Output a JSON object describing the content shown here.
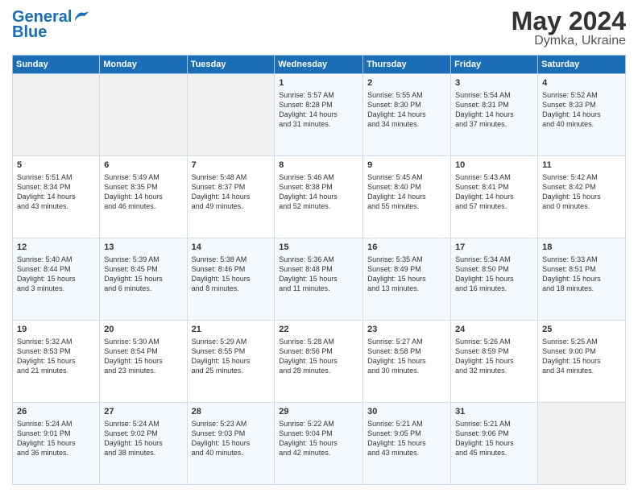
{
  "header": {
    "logo_line1": "General",
    "logo_line2": "Blue",
    "month": "May 2024",
    "location": "Dymka, Ukraine"
  },
  "weekdays": [
    "Sunday",
    "Monday",
    "Tuesday",
    "Wednesday",
    "Thursday",
    "Friday",
    "Saturday"
  ],
  "weeks": [
    [
      {
        "day": null,
        "info": null
      },
      {
        "day": null,
        "info": null
      },
      {
        "day": null,
        "info": null
      },
      {
        "day": "1",
        "info": "Sunrise: 5:57 AM\nSunset: 8:28 PM\nDaylight: 14 hours\nand 31 minutes."
      },
      {
        "day": "2",
        "info": "Sunrise: 5:55 AM\nSunset: 8:30 PM\nDaylight: 14 hours\nand 34 minutes."
      },
      {
        "day": "3",
        "info": "Sunrise: 5:54 AM\nSunset: 8:31 PM\nDaylight: 14 hours\nand 37 minutes."
      },
      {
        "day": "4",
        "info": "Sunrise: 5:52 AM\nSunset: 8:33 PM\nDaylight: 14 hours\nand 40 minutes."
      }
    ],
    [
      {
        "day": "5",
        "info": "Sunrise: 5:51 AM\nSunset: 8:34 PM\nDaylight: 14 hours\nand 43 minutes."
      },
      {
        "day": "6",
        "info": "Sunrise: 5:49 AM\nSunset: 8:35 PM\nDaylight: 14 hours\nand 46 minutes."
      },
      {
        "day": "7",
        "info": "Sunrise: 5:48 AM\nSunset: 8:37 PM\nDaylight: 14 hours\nand 49 minutes."
      },
      {
        "day": "8",
        "info": "Sunrise: 5:46 AM\nSunset: 8:38 PM\nDaylight: 14 hours\nand 52 minutes."
      },
      {
        "day": "9",
        "info": "Sunrise: 5:45 AM\nSunset: 8:40 PM\nDaylight: 14 hours\nand 55 minutes."
      },
      {
        "day": "10",
        "info": "Sunrise: 5:43 AM\nSunset: 8:41 PM\nDaylight: 14 hours\nand 57 minutes."
      },
      {
        "day": "11",
        "info": "Sunrise: 5:42 AM\nSunset: 8:42 PM\nDaylight: 15 hours\nand 0 minutes."
      }
    ],
    [
      {
        "day": "12",
        "info": "Sunrise: 5:40 AM\nSunset: 8:44 PM\nDaylight: 15 hours\nand 3 minutes."
      },
      {
        "day": "13",
        "info": "Sunrise: 5:39 AM\nSunset: 8:45 PM\nDaylight: 15 hours\nand 6 minutes."
      },
      {
        "day": "14",
        "info": "Sunrise: 5:38 AM\nSunset: 8:46 PM\nDaylight: 15 hours\nand 8 minutes."
      },
      {
        "day": "15",
        "info": "Sunrise: 5:36 AM\nSunset: 8:48 PM\nDaylight: 15 hours\nand 11 minutes."
      },
      {
        "day": "16",
        "info": "Sunrise: 5:35 AM\nSunset: 8:49 PM\nDaylight: 15 hours\nand 13 minutes."
      },
      {
        "day": "17",
        "info": "Sunrise: 5:34 AM\nSunset: 8:50 PM\nDaylight: 15 hours\nand 16 minutes."
      },
      {
        "day": "18",
        "info": "Sunrise: 5:33 AM\nSunset: 8:51 PM\nDaylight: 15 hours\nand 18 minutes."
      }
    ],
    [
      {
        "day": "19",
        "info": "Sunrise: 5:32 AM\nSunset: 8:53 PM\nDaylight: 15 hours\nand 21 minutes."
      },
      {
        "day": "20",
        "info": "Sunrise: 5:30 AM\nSunset: 8:54 PM\nDaylight: 15 hours\nand 23 minutes."
      },
      {
        "day": "21",
        "info": "Sunrise: 5:29 AM\nSunset: 8:55 PM\nDaylight: 15 hours\nand 25 minutes."
      },
      {
        "day": "22",
        "info": "Sunrise: 5:28 AM\nSunset: 8:56 PM\nDaylight: 15 hours\nand 28 minutes."
      },
      {
        "day": "23",
        "info": "Sunrise: 5:27 AM\nSunset: 8:58 PM\nDaylight: 15 hours\nand 30 minutes."
      },
      {
        "day": "24",
        "info": "Sunrise: 5:26 AM\nSunset: 8:59 PM\nDaylight: 15 hours\nand 32 minutes."
      },
      {
        "day": "25",
        "info": "Sunrise: 5:25 AM\nSunset: 9:00 PM\nDaylight: 15 hours\nand 34 minutes."
      }
    ],
    [
      {
        "day": "26",
        "info": "Sunrise: 5:24 AM\nSunset: 9:01 PM\nDaylight: 15 hours\nand 36 minutes."
      },
      {
        "day": "27",
        "info": "Sunrise: 5:24 AM\nSunset: 9:02 PM\nDaylight: 15 hours\nand 38 minutes."
      },
      {
        "day": "28",
        "info": "Sunrise: 5:23 AM\nSunset: 9:03 PM\nDaylight: 15 hours\nand 40 minutes."
      },
      {
        "day": "29",
        "info": "Sunrise: 5:22 AM\nSunset: 9:04 PM\nDaylight: 15 hours\nand 42 minutes."
      },
      {
        "day": "30",
        "info": "Sunrise: 5:21 AM\nSunset: 9:05 PM\nDaylight: 15 hours\nand 43 minutes."
      },
      {
        "day": "31",
        "info": "Sunrise: 5:21 AM\nSunset: 9:06 PM\nDaylight: 15 hours\nand 45 minutes."
      },
      {
        "day": null,
        "info": null
      }
    ]
  ]
}
